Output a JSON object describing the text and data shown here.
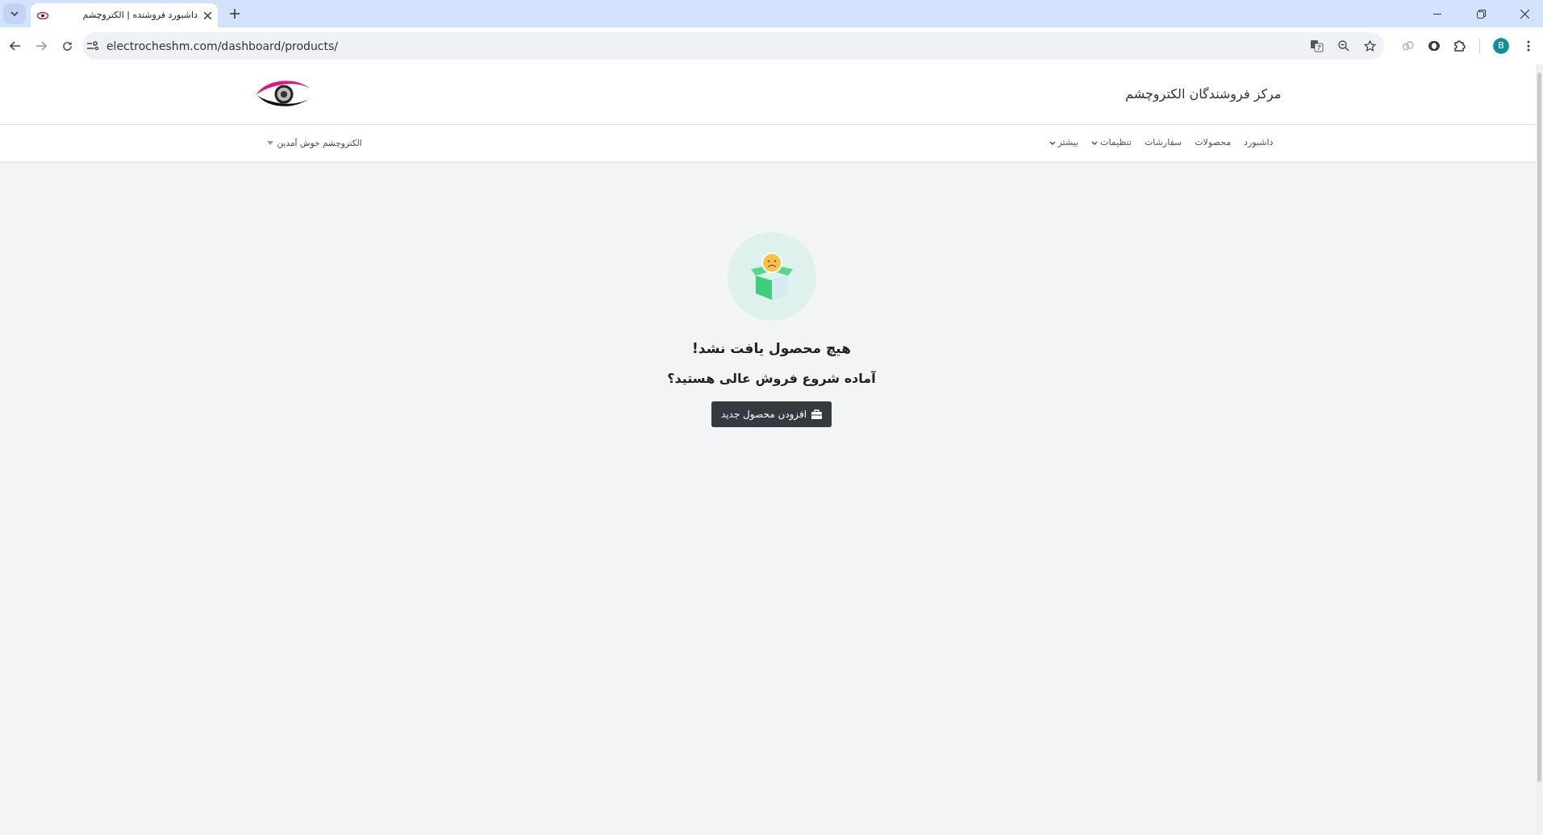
{
  "browser": {
    "tabs": [
      {
        "title": "داشبورد فروشنده | الکتروچشم",
        "selected": true
      }
    ],
    "url": "electrocheshm.com/dashboard/products/",
    "profile_initial": "B"
  },
  "header": {
    "title": "مرکز فروشندگان الکتروچشم"
  },
  "nav": {
    "items": [
      {
        "label": "داشبورد",
        "kind": "link"
      },
      {
        "label": "محصولات",
        "kind": "link"
      },
      {
        "label": "سفارشات",
        "kind": "link"
      },
      {
        "label": "تنظیمات",
        "kind": "dropdown"
      },
      {
        "label": "بیشتر",
        "kind": "dropdown"
      }
    ],
    "user_menu": "الکتروچشم خوش آمدین"
  },
  "empty_state": {
    "title": "هیچ محصول یافت نشد!",
    "subtitle": "آماده شروع فروش عالی هستید؟",
    "button": "افزودن محصول جدید"
  }
}
